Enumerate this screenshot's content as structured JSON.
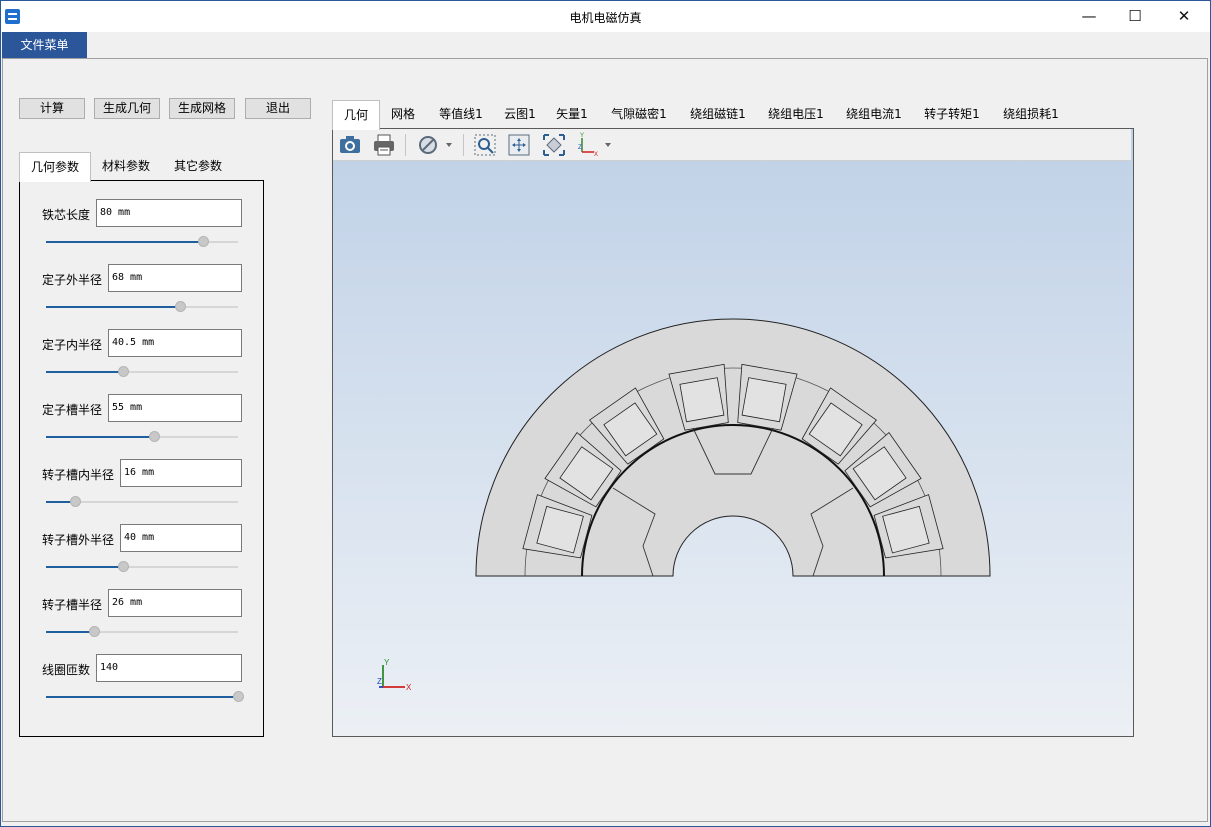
{
  "window": {
    "title": "电机电磁仿真",
    "controls": {
      "minimize": "—",
      "maximize": "☐",
      "close": "✕"
    }
  },
  "menu": {
    "file": "文件菜单"
  },
  "actions": {
    "calc": "计算",
    "gen_geometry": "生成几何",
    "gen_mesh": "生成网格",
    "exit": "退出"
  },
  "left_tabs": [
    "几何参数",
    "材料参数",
    "其它参数"
  ],
  "params": [
    {
      "label": "铁芯长度",
      "value": "80 mm",
      "slider": 0.82
    },
    {
      "label": "定子外半径",
      "value": "68 mm",
      "slider": 0.7
    },
    {
      "label": "定子内半径",
      "value": "40.5 mm",
      "slider": 0.4
    },
    {
      "label": "定子槽半径",
      "value": "55 mm",
      "slider": 0.56
    },
    {
      "label": "转子槽内半径",
      "value": "16 mm",
      "slider": 0.15
    },
    {
      "label": "转子槽外半径",
      "value": "40 mm",
      "slider": 0.4
    },
    {
      "label": "转子槽半径",
      "value": "26 mm",
      "slider": 0.25
    },
    {
      "label": "线圈匝数",
      "value": "140",
      "slider": 1.0
    }
  ],
  "view_tabs": [
    "几何",
    "网格",
    "等值线1",
    "云图1",
    "矢量1",
    "气隙磁密1",
    "绕组磁链1",
    "绕组电压1",
    "绕组电流1",
    "转子转矩1",
    "绕组损耗1"
  ],
  "toolbar_icons": [
    "camera-icon",
    "print-icon",
    "display-mode-icon",
    "zoom-box-icon",
    "pan-icon",
    "fit-view-icon",
    "axes-icon"
  ],
  "triad": {
    "x": "X",
    "y": "Y",
    "z": "Z"
  },
  "colors": {
    "accent": "#2b579a",
    "slider_fill": "#1f5fa0",
    "geometry_fill": "#d9d9d9",
    "view_top": "#bfd1e7",
    "view_bottom": "#ecf0f5"
  }
}
